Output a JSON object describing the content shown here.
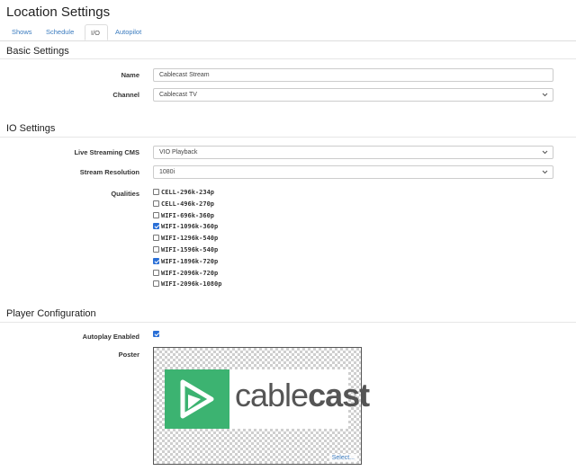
{
  "page": {
    "title": "Location Settings"
  },
  "tabs": [
    {
      "label": "Shows",
      "active": false
    },
    {
      "label": "Schedule",
      "active": false
    },
    {
      "label": "I/O",
      "active": true
    },
    {
      "label": "Autopilot",
      "active": false
    }
  ],
  "basic": {
    "title": "Basic Settings",
    "name_label": "Name",
    "name_value": "Cablecast Stream",
    "channel_label": "Channel",
    "channel_value": "Cablecast TV"
  },
  "io": {
    "title": "IO Settings",
    "cms_label": "Live Streaming CMS",
    "cms_value": "VIO Playback",
    "resolution_label": "Stream Resolution",
    "resolution_value": "1080i",
    "qualities_label": "Qualities",
    "qualities": [
      {
        "label": "CELL-296k-234p",
        "checked": false
      },
      {
        "label": "CELL-496k-270p",
        "checked": false
      },
      {
        "label": "WIFI-696k-360p",
        "checked": false
      },
      {
        "label": "WIFI-1096k-360p",
        "checked": true
      },
      {
        "label": "WIFI-1296k-540p",
        "checked": false
      },
      {
        "label": "WIFI-1596k-540p",
        "checked": false
      },
      {
        "label": "WIFI-1896k-720p",
        "checked": true
      },
      {
        "label": "WIFI-2096k-720p",
        "checked": false
      },
      {
        "label": "WIFI-2096k-1080p",
        "checked": false
      }
    ]
  },
  "player": {
    "title": "Player Configuration",
    "autoplay_label": "Autoplay Enabled",
    "autoplay_checked": true,
    "poster_label": "Poster",
    "poster_logo_text_light": "cable",
    "poster_logo_text_bold": "cast",
    "poster_select_label": "Select..."
  },
  "colors": {
    "link": "#3a7bbf",
    "logo_green": "#3cb371",
    "checkbox": "#2a6fd6"
  },
  "icons": {
    "select_caret": "chevron-down-icon",
    "poster_logo": "play-arrow-icon"
  }
}
